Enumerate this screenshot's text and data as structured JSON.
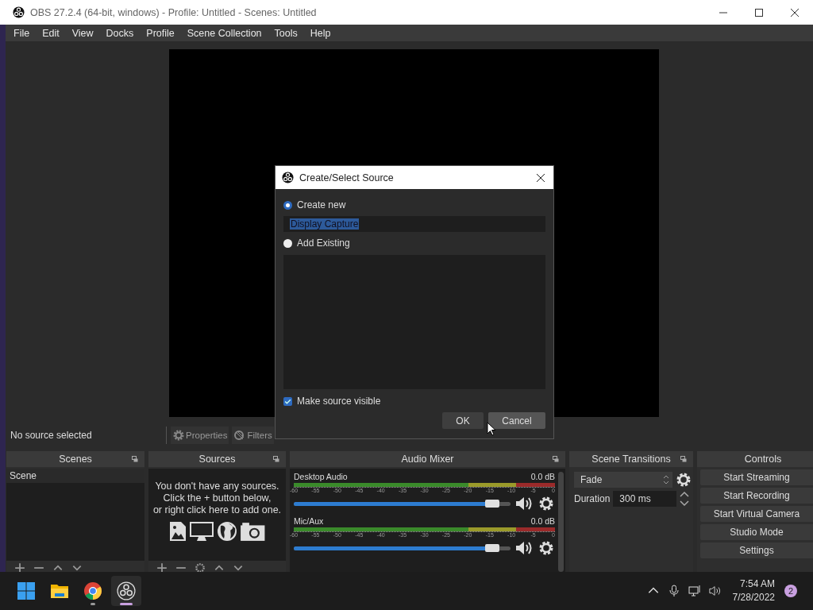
{
  "window": {
    "title": "OBS 27.2.4 (64-bit, windows) - Profile: Untitled - Scenes: Untitled"
  },
  "menu": [
    "File",
    "Edit",
    "View",
    "Docks",
    "Profile",
    "Scene Collection",
    "Tools",
    "Help"
  ],
  "status_bar": {
    "message": "No source selected",
    "buttons": [
      "Properties",
      "Filters"
    ]
  },
  "scenes": {
    "title": "Scenes",
    "items": [
      {
        "label": "Scene",
        "selected": true
      }
    ]
  },
  "sources": {
    "title": "Sources",
    "empty_message": "You don't have any sources.\nClick the + button below,\nor right click here to add one."
  },
  "audio_mixer": {
    "title": "Audio Mixer",
    "channels": [
      {
        "name": "Desktop Audio",
        "reading": "0.0 dB",
        "level": 0.95,
        "scale": [
          "-60",
          "-55",
          "-50",
          "-45",
          "-40",
          "-35",
          "-30",
          "-25",
          "-20",
          "-15",
          "-10",
          "-5",
          "0"
        ]
      },
      {
        "name": "Mic/Aux",
        "reading": "0.0 dB",
        "level": 0.95,
        "scale": [
          "-60",
          "-55",
          "-50",
          "-45",
          "-40",
          "-35",
          "-30",
          "-25",
          "-20",
          "-15",
          "-10",
          "-5",
          "0"
        ]
      }
    ]
  },
  "scene_transitions": {
    "title": "Scene Transitions",
    "transition": "Fade",
    "duration_label": "Duration",
    "duration": "300 ms"
  },
  "controls": {
    "title": "Controls",
    "buttons": [
      "Start Streaming",
      "Start Recording",
      "Start Virtual Camera",
      "Studio Mode",
      "Settings"
    ]
  },
  "dialog": {
    "title": "Create/Select Source",
    "options": [
      {
        "label": "Create new",
        "selected": true
      },
      {
        "label": "Add Existing",
        "selected": false
      }
    ],
    "name_value": "Display Capture",
    "visible_label": "Make source visible",
    "visible_checked": true,
    "buttons": [
      "OK",
      "Cancel"
    ]
  },
  "taskbar": {
    "apps": [
      {
        "kind": "start",
        "running": false,
        "active": false
      },
      {
        "kind": "folder",
        "running": false,
        "active": false
      },
      {
        "kind": "browser",
        "running": true,
        "active": false
      },
      {
        "kind": "obs",
        "running": true,
        "active": true
      }
    ],
    "time": "7:54 AM",
    "date": "7/28/2022",
    "notifications": "2"
  }
}
